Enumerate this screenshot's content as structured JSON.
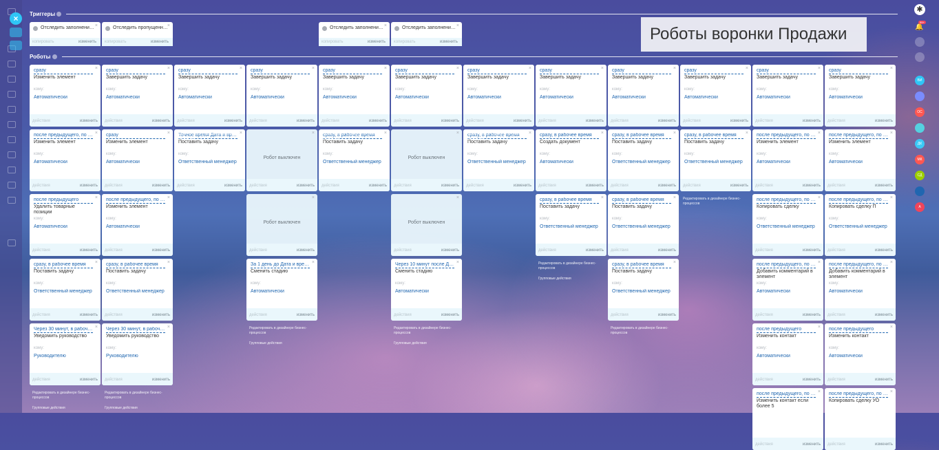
{
  "page_title": "Роботы воронки Продажи",
  "sections": {
    "triggers": "Триггеры",
    "robots": "Роботы"
  },
  "common": {
    "copy": "копировать",
    "change": "изменить",
    "actions": "действия",
    "to_whom": "кому:",
    "robot_off": "Робот выключен",
    "edit_in_designer": "Редактировать в дизайнере бизнес-процессов",
    "group_actions": "Групповые действия"
  },
  "triggers": [
    {
      "text": "Отследить заполнение поля"
    },
    {
      "text": "Отследить пропущенный звонок"
    },
    {
      "text": "Отследить заполнение поля"
    },
    {
      "text": "Отследить заполнение поля"
    }
  ],
  "robots": [
    {
      "condition": "сразу",
      "action": "Изменить элемент",
      "who": "Автоматически"
    },
    {
      "condition": "сразу",
      "action": "Завершить задачу",
      "who": "Автоматически"
    },
    {
      "condition": "сразу",
      "action": "Завершить задачу",
      "who": "Автоматически"
    },
    {
      "condition": "сразу",
      "action": "Завершить задачу",
      "who": "Автоматически"
    },
    {
      "condition": "сразу",
      "action": "Завершить задачу",
      "who": "Автоматически"
    },
    {
      "condition": "сразу",
      "action": "Завершить задачу",
      "who": "Автоматически"
    },
    {
      "condition": "сразу",
      "action": "Завершить задачу",
      "who": "Автоматически"
    },
    {
      "condition": "сразу",
      "action": "Завершить задачу",
      "who": "Автоматически"
    },
    {
      "condition": "сразу",
      "action": "Завершить задачу",
      "who": "Автоматически"
    },
    {
      "condition": "сразу",
      "action": "Завершить задачу",
      "who": "Автоматически"
    },
    {
      "condition": "сразу",
      "action": "Завершить задачу",
      "who": "Автоматически"
    },
    {
      "condition": "сразу",
      "action": "Завершить задачу",
      "who": "Автоматически"
    },
    {
      "condition": "после предыдущего, по умолчанию",
      "action": "Изменить элемент",
      "who": "Автоматически"
    },
    {
      "condition": "сразу",
      "action": "Изменить элемент",
      "who": "Автоматически"
    },
    {
      "condition": "Точное время Дата и время",
      "action": "Поставить задачу",
      "who": "Ответственный менеджер"
    },
    {
      "condition": "сразу, в рабочее время",
      "action": "Поставить задачу",
      "who": "Ответственный менеджер"
    },
    {
      "condition": "сразу, в рабочее время",
      "action": "Поставить задачу",
      "who": "Ответственный менеджер"
    },
    {
      "condition": "сразу, в рабочее время",
      "action": "Создать документ",
      "who": "Автоматически"
    },
    {
      "condition": "сразу, в рабочее время",
      "action": "Поставить задачу",
      "who": "Ответственный менеджер"
    },
    {
      "condition": "сразу, в рабочее время",
      "action": "Поставить задачу",
      "who": "Ответственный менеджер"
    },
    {
      "condition": "после предыдущего, по умолчанию",
      "action": "Изменить элемент",
      "who": "Автоматически"
    },
    {
      "condition": "после предыдущего, по умолчанию",
      "action": "Изменить элемент",
      "who": "Автоматически"
    },
    {
      "condition": "после предыдущего",
      "action": "Удалить товарные позиции",
      "who": "Автоматически"
    },
    {
      "condition": "после предыдущего, по умолчанию",
      "action": "Изменить элемент",
      "who": "Автоматически"
    },
    {
      "condition": "сразу, в рабочее время",
      "action": "Поставить задачу",
      "who": "Ответственный менеджер"
    },
    {
      "condition": "сразу, в рабочее время",
      "action": "Поставить задачу",
      "who": "Ответственный менеджер"
    },
    {
      "condition": "после предыдущего, по умолчанию",
      "action": "Копировать сделку",
      "who": "Ответственный менеджер"
    },
    {
      "condition": "после предыдущего, по умолчанию",
      "action": "Копировать сделку П",
      "who": "Ответственный менеджер"
    },
    {
      "condition": "сразу, в рабочее время",
      "action": "Поставить задачу",
      "who": "Ответственный менеджер"
    },
    {
      "condition": "сразу, в рабочее время",
      "action": "Поставить задачу",
      "who": "Ответственный менеджер"
    },
    {
      "condition": "За 1 день до Дата и время",
      "action": "Сменить стадию",
      "who": "Автоматически"
    },
    {
      "condition": "Через 10 минут после Дата и время",
      "action": "Сменить стадию",
      "who": "Автоматически"
    },
    {
      "condition": "сразу, в рабочее время",
      "action": "Поставить задачу",
      "who": "Ответственный менеджер"
    },
    {
      "condition": "после предыдущего, по умолчанию",
      "action": "Добавить комментарий в элемент",
      "who": "Автоматически"
    },
    {
      "condition": "после предыдущего, по умолчанию",
      "action": "Добавить комментарий в элемент",
      "who": "Автоматически"
    },
    {
      "condition": "Через 30 минут, в рабочее время",
      "action": "Уведомить руководство",
      "who": "Руководителю"
    },
    {
      "condition": "Через 30 минут, в рабочее время",
      "action": "Уведомить руководство",
      "who": "Руководителю"
    },
    {
      "condition": "после предыдущего",
      "action": "Изменить контакт",
      "who": "Автоматически"
    },
    {
      "condition": "после предыдущего",
      "action": "Изменить контакт",
      "who": "Автоматически"
    },
    {
      "condition": "после предыдущего, по умолчанию",
      "action": "Изменить контакт если более 5"
    },
    {
      "condition": "после предыдущего, по умолчанию",
      "action": "Копировать сделку УО"
    }
  ],
  "right_sidebar": {
    "badge": "99+",
    "avatars": [
      "ВИ",
      "ОС",
      "ДК",
      "МК",
      "СД",
      "А"
    ]
  }
}
